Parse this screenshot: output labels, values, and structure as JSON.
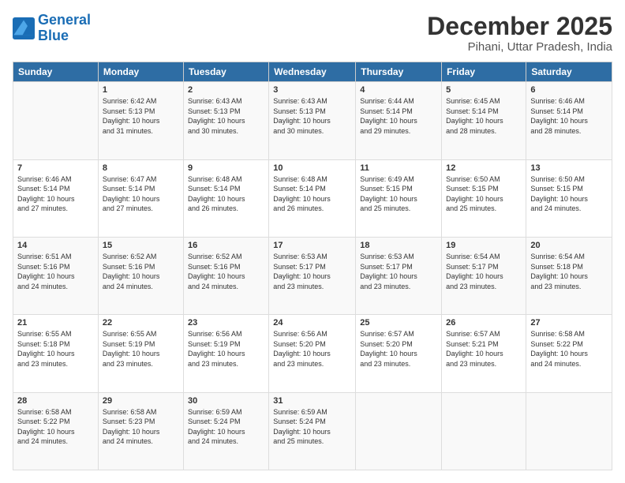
{
  "logo": {
    "line1": "General",
    "line2": "Blue"
  },
  "header": {
    "month": "December 2025",
    "location": "Pihani, Uttar Pradesh, India"
  },
  "weekdays": [
    "Sunday",
    "Monday",
    "Tuesday",
    "Wednesday",
    "Thursday",
    "Friday",
    "Saturday"
  ],
  "weeks": [
    [
      {
        "day": "",
        "info": ""
      },
      {
        "day": "1",
        "info": "Sunrise: 6:42 AM\nSunset: 5:13 PM\nDaylight: 10 hours\nand 31 minutes."
      },
      {
        "day": "2",
        "info": "Sunrise: 6:43 AM\nSunset: 5:13 PM\nDaylight: 10 hours\nand 30 minutes."
      },
      {
        "day": "3",
        "info": "Sunrise: 6:43 AM\nSunset: 5:13 PM\nDaylight: 10 hours\nand 30 minutes."
      },
      {
        "day": "4",
        "info": "Sunrise: 6:44 AM\nSunset: 5:14 PM\nDaylight: 10 hours\nand 29 minutes."
      },
      {
        "day": "5",
        "info": "Sunrise: 6:45 AM\nSunset: 5:14 PM\nDaylight: 10 hours\nand 28 minutes."
      },
      {
        "day": "6",
        "info": "Sunrise: 6:46 AM\nSunset: 5:14 PM\nDaylight: 10 hours\nand 28 minutes."
      }
    ],
    [
      {
        "day": "7",
        "info": "Sunrise: 6:46 AM\nSunset: 5:14 PM\nDaylight: 10 hours\nand 27 minutes."
      },
      {
        "day": "8",
        "info": "Sunrise: 6:47 AM\nSunset: 5:14 PM\nDaylight: 10 hours\nand 27 minutes."
      },
      {
        "day": "9",
        "info": "Sunrise: 6:48 AM\nSunset: 5:14 PM\nDaylight: 10 hours\nand 26 minutes."
      },
      {
        "day": "10",
        "info": "Sunrise: 6:48 AM\nSunset: 5:14 PM\nDaylight: 10 hours\nand 26 minutes."
      },
      {
        "day": "11",
        "info": "Sunrise: 6:49 AM\nSunset: 5:15 PM\nDaylight: 10 hours\nand 25 minutes."
      },
      {
        "day": "12",
        "info": "Sunrise: 6:50 AM\nSunset: 5:15 PM\nDaylight: 10 hours\nand 25 minutes."
      },
      {
        "day": "13",
        "info": "Sunrise: 6:50 AM\nSunset: 5:15 PM\nDaylight: 10 hours\nand 24 minutes."
      }
    ],
    [
      {
        "day": "14",
        "info": "Sunrise: 6:51 AM\nSunset: 5:16 PM\nDaylight: 10 hours\nand 24 minutes."
      },
      {
        "day": "15",
        "info": "Sunrise: 6:52 AM\nSunset: 5:16 PM\nDaylight: 10 hours\nand 24 minutes."
      },
      {
        "day": "16",
        "info": "Sunrise: 6:52 AM\nSunset: 5:16 PM\nDaylight: 10 hours\nand 24 minutes."
      },
      {
        "day": "17",
        "info": "Sunrise: 6:53 AM\nSunset: 5:17 PM\nDaylight: 10 hours\nand 23 minutes."
      },
      {
        "day": "18",
        "info": "Sunrise: 6:53 AM\nSunset: 5:17 PM\nDaylight: 10 hours\nand 23 minutes."
      },
      {
        "day": "19",
        "info": "Sunrise: 6:54 AM\nSunset: 5:17 PM\nDaylight: 10 hours\nand 23 minutes."
      },
      {
        "day": "20",
        "info": "Sunrise: 6:54 AM\nSunset: 5:18 PM\nDaylight: 10 hours\nand 23 minutes."
      }
    ],
    [
      {
        "day": "21",
        "info": "Sunrise: 6:55 AM\nSunset: 5:18 PM\nDaylight: 10 hours\nand 23 minutes."
      },
      {
        "day": "22",
        "info": "Sunrise: 6:55 AM\nSunset: 5:19 PM\nDaylight: 10 hours\nand 23 minutes."
      },
      {
        "day": "23",
        "info": "Sunrise: 6:56 AM\nSunset: 5:19 PM\nDaylight: 10 hours\nand 23 minutes."
      },
      {
        "day": "24",
        "info": "Sunrise: 6:56 AM\nSunset: 5:20 PM\nDaylight: 10 hours\nand 23 minutes."
      },
      {
        "day": "25",
        "info": "Sunrise: 6:57 AM\nSunset: 5:20 PM\nDaylight: 10 hours\nand 23 minutes."
      },
      {
        "day": "26",
        "info": "Sunrise: 6:57 AM\nSunset: 5:21 PM\nDaylight: 10 hours\nand 23 minutes."
      },
      {
        "day": "27",
        "info": "Sunrise: 6:58 AM\nSunset: 5:22 PM\nDaylight: 10 hours\nand 24 minutes."
      }
    ],
    [
      {
        "day": "28",
        "info": "Sunrise: 6:58 AM\nSunset: 5:22 PM\nDaylight: 10 hours\nand 24 minutes."
      },
      {
        "day": "29",
        "info": "Sunrise: 6:58 AM\nSunset: 5:23 PM\nDaylight: 10 hours\nand 24 minutes."
      },
      {
        "day": "30",
        "info": "Sunrise: 6:59 AM\nSunset: 5:24 PM\nDaylight: 10 hours\nand 24 minutes."
      },
      {
        "day": "31",
        "info": "Sunrise: 6:59 AM\nSunset: 5:24 PM\nDaylight: 10 hours\nand 25 minutes."
      },
      {
        "day": "",
        "info": ""
      },
      {
        "day": "",
        "info": ""
      },
      {
        "day": "",
        "info": ""
      }
    ]
  ]
}
